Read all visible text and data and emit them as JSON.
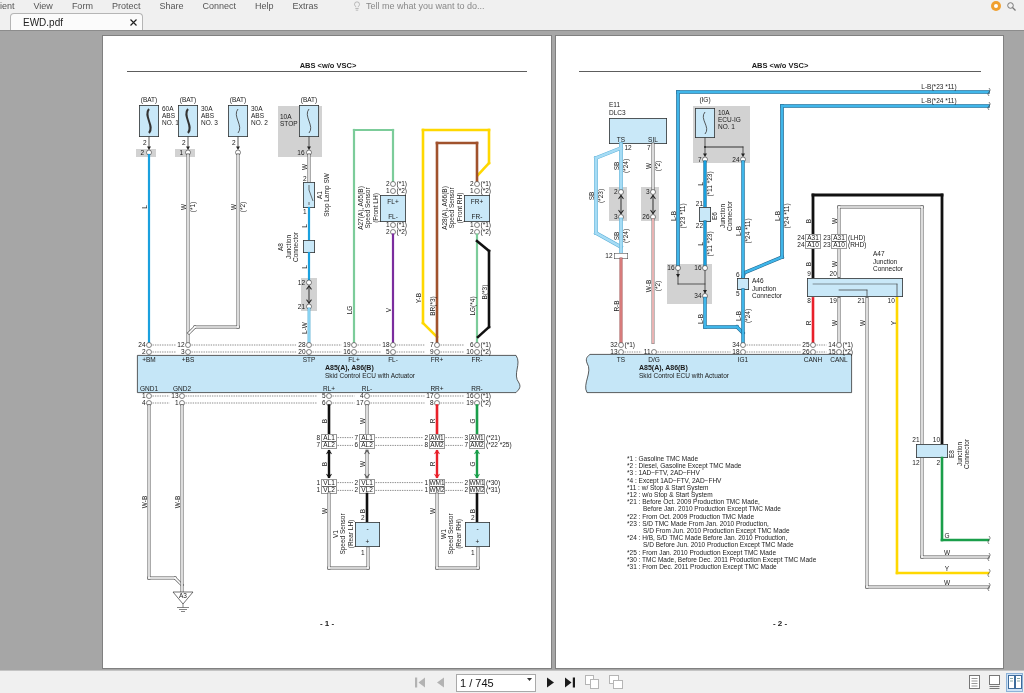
{
  "menu": [
    "ient",
    "View",
    "Form",
    "Protect",
    "Share",
    "Connect",
    "Help",
    "Extras"
  ],
  "search": {
    "placeholder": "Tell me what you want to do..."
  },
  "tabs": [
    {
      "label": "EWD.pdf",
      "selected": true
    }
  ],
  "pages": [
    {
      "title": "ABS <w/o VSC>",
      "fuses": [
        {
          "source": "(BAT)",
          "lines": [
            "60A",
            "ABS",
            "NO. 1"
          ]
        },
        {
          "source": "(BAT)",
          "lines": [
            "30A",
            "ABS",
            "NO. 3"
          ]
        },
        {
          "source": "(BAT)",
          "lines": [
            "30A",
            "ABS",
            "NO. 2"
          ]
        },
        {
          "source": "(BAT)",
          "lines": [
            "10A",
            "STOP"
          ]
        }
      ],
      "components": [
        {
          "lines": [
            "A1",
            "Stop Lamp SW"
          ]
        },
        {
          "lines": [
            "A8",
            "Junction",
            "Connector"
          ]
        },
        {
          "lines": [
            "A27(A), A65(B)",
            "Speed Sensor",
            "(Front LH)"
          ]
        },
        {
          "lines": [
            "A28(A), A66(B)",
            "Speed Sensor",
            "(Front RH)"
          ]
        },
        {
          "lines": [
            "V1",
            "Speed Sensor",
            "(Rear LH)"
          ]
        },
        {
          "lines": [
            "W1",
            "Speed Sensor",
            "(Rear RH)"
          ]
        }
      ],
      "sensors": [
        {
          "top": "FL+",
          "bottom": "FL-"
        },
        {
          "top": "FR+",
          "bottom": "FR-"
        },
        {
          "top": "-",
          "bottom": "+"
        },
        {
          "top": "-",
          "bottom": "+"
        }
      ],
      "ecu": {
        "name": "A85(A), A86(B)",
        "description": "Skid Control ECU with Actuator",
        "top_pins": [
          {
            "name": "+BM",
            "pin_a": "24",
            "pin_b": "2"
          },
          {
            "name": "+BS",
            "pin_a": "12",
            "pin_b": "3"
          },
          {
            "name": "STP",
            "pin_a": "28",
            "pin_b": "20"
          },
          {
            "name": "FL+",
            "pin_a": "19",
            "pin_b": "16"
          },
          {
            "name": "FL-",
            "pin_a": "18",
            "pin_b": "5"
          },
          {
            "name": "FR+",
            "pin_a": "7",
            "pin_b": "9"
          },
          {
            "name": "FR-",
            "pin_a": "6",
            "pin_b": "10"
          }
        ],
        "bottom_pins": [
          {
            "name": "GND1",
            "pin_a": "1",
            "pin_b": "4"
          },
          {
            "name": "GND2",
            "pin_a": "13",
            "pin_b": "1"
          },
          {
            "name": "RL+",
            "pin_a": "5",
            "pin_b": "6"
          },
          {
            "name": "RL-",
            "pin_a": "4",
            "pin_b": "17"
          },
          {
            "name": "RR+",
            "pin_a": "17",
            "pin_b": "8"
          },
          {
            "name": "RR-",
            "pin_a": "16",
            "pin_b": "19"
          }
        ]
      },
      "connectors": [
        "AL1",
        "AL1",
        "AM1",
        "AM1",
        "AL2",
        "AL2",
        "AM2",
        "AM2",
        "VL1",
        "VL1",
        "WM1",
        "WM1",
        "VL2",
        "VL2",
        "WM2",
        "WM2"
      ],
      "pin_numbers": [
        "2",
        "2",
        "2",
        "2",
        "1",
        "16",
        "2",
        "1",
        "12",
        "21",
        "2",
        "1",
        "1",
        "2",
        "2",
        "1",
        "1",
        "2",
        "8",
        "7",
        "2",
        "3",
        "7",
        "6",
        "8",
        "7",
        "1",
        "2",
        "1",
        "2",
        "1",
        "2",
        "1",
        "2",
        "2",
        "1",
        "2",
        "1"
      ],
      "notes": [
        "(*1)",
        "(*2)",
        "(*1)",
        "(*2)",
        "(*1)",
        "(*2)",
        "(*1)",
        "(*2)",
        "(*1)",
        "(*2)",
        "(*1)",
        "(*2)",
        "(*21)",
        "(*22 *25)",
        "(*30)",
        "(*31)"
      ],
      "wire_codes": [
        "L",
        "W",
        "(*1)",
        "W",
        "(*2)",
        "W",
        "L",
        "L",
        "L-W",
        "LG",
        "V",
        "Y-B",
        "BR(*3)",
        "LG(*4)",
        "B(*3)",
        "B",
        "W",
        "R",
        "G",
        "B",
        "W",
        "R",
        "G",
        "W",
        "B",
        "W",
        "B",
        "W-B",
        "W-B"
      ],
      "ground": "A3",
      "page_number": "- 1 -"
    },
    {
      "title": "ABS <w/o VSC>",
      "fuses": [
        {
          "source": "(IG)",
          "lines": [
            "10A",
            "ECU-IG",
            "NO. 1"
          ]
        }
      ],
      "dlc": {
        "lines": [
          "E11",
          "DLC3"
        ],
        "pins": [
          "TS",
          "SIL"
        ]
      },
      "components": [
        {
          "lines": [
            "E6",
            "Junction",
            "Connector"
          ]
        },
        {
          "lines": [
            "A46",
            "Junction",
            "Connector"
          ]
        },
        {
          "lines": [
            "A47",
            "Junction",
            "Connector"
          ]
        },
        {
          "lines": [
            "E8",
            "Junction",
            "Connector"
          ]
        }
      ],
      "ecu": {
        "name": "A85(A), A86(B)",
        "description": "Skid Control ECU with Actuator",
        "top_pins": [
          {
            "name": "TS",
            "pin_a": "32",
            "pin_b": "13"
          },
          {
            "name": "D/G",
            "pin_b": "11"
          },
          {
            "name": "IG1",
            "pin_a": "34",
            "pin_b": "18"
          },
          {
            "name": "CANH",
            "pin_a": "25",
            "pin_b": "26"
          },
          {
            "name": "CANL",
            "pin_a": "14",
            "pin_b": "15"
          }
        ]
      },
      "connectors": [
        "A31",
        "A31",
        "A10",
        "A10"
      ],
      "pin_numbers": [
        "12",
        "7",
        "2",
        "3",
        "3",
        "26",
        "12",
        "7",
        "24",
        "21",
        "22",
        "16",
        "16",
        "34",
        "6",
        "5",
        "24",
        "23",
        "24",
        "23",
        "9",
        "20",
        "8",
        "19",
        "21",
        "10",
        "21",
        "10",
        "12",
        "2"
      ],
      "notes": [
        "(*1)",
        "(*1)",
        "(*2)",
        "(LHD)",
        "(RHD)"
      ],
      "wire_codes": [
        "L-B(*23 *11)",
        "L-B(*24 *11)",
        "SB",
        "(*24)",
        "SB",
        "(*24)",
        "SB",
        "(*23)",
        "W",
        "(*2)",
        "W-B",
        "(*2)",
        "R-B",
        "L-B",
        "(*23 *11)",
        "L",
        "(*11 *23)",
        "L",
        "(*11 *23)",
        "L-B",
        "(*24 *11)",
        "L-B",
        "(*24 *11)",
        "L-B",
        "L-B",
        "(*24)",
        "B",
        "W",
        "B",
        "W",
        "R",
        "W",
        "W",
        "Y",
        "G",
        "W",
        "Y",
        "W"
      ],
      "legend": [
        {
          "kind": "note",
          "text": "*1 : Gasoline TMC Made"
        },
        {
          "kind": "note",
          "text": "*2 : Diesel,  Gasoline Except TMC Made"
        },
        {
          "kind": "note",
          "text": "*3 : 1AD−FTV,  2AD−FHV"
        },
        {
          "kind": "note",
          "text": "*4 : Except 1AD−FTV,  2AD−FHV"
        },
        {
          "kind": "note",
          "text": "*11 : w/ Stop & Start System"
        },
        {
          "kind": "note",
          "text": "*12 : w/o Stop & Start System"
        },
        {
          "kind": "note",
          "text": "*21 : Before Oct.  2009 Production TMC Made,"
        },
        {
          "kind": "continued",
          "text": "Before Jan.  2010 Production Except TMC Made"
        },
        {
          "kind": "note",
          "text": "*22 : From Oct.  2009 Production TMC Made"
        },
        {
          "kind": "note",
          "text": "*23 : S/D TMC Made From Jan.  2010 Production,"
        },
        {
          "kind": "continued",
          "text": "S/D From Jun.  2010 Production Except TMC Made"
        },
        {
          "kind": "note",
          "text": "*24 : H/B,  S/D TMC Made Before Jan.  2010 Production,"
        },
        {
          "kind": "continued",
          "text": "S/D Before Jun.  2010 Production Except TMC Made"
        },
        {
          "kind": "note",
          "text": "*25 : From Jan.  2010 Production Except TMC Made"
        },
        {
          "kind": "note",
          "text": "*30 : TMC Made,  Before Dec.  2011 Production Except TMC Made"
        },
        {
          "kind": "note",
          "text": "*31 : From Dec.  2011 Production Except TMC Made"
        }
      ],
      "page_number": "- 2 -"
    }
  ],
  "pager": {
    "buttons": [
      {
        "kind": "first",
        "disabled": true
      },
      {
        "kind": "previous",
        "disabled": true
      },
      {
        "kind": "next",
        "disabled": false
      },
      {
        "kind": "last",
        "disabled": false
      }
    ],
    "page_field": {
      "value": "1 / 745"
    },
    "tools": [
      {
        "kind": "copy",
        "disabled": true
      },
      {
        "kind": "paste",
        "disabled": true
      }
    ],
    "view_modes": [
      {
        "kind": "single",
        "selected": false
      },
      {
        "kind": "continuous",
        "selected": false
      },
      {
        "kind": "facing",
        "selected": true
      }
    ]
  }
}
